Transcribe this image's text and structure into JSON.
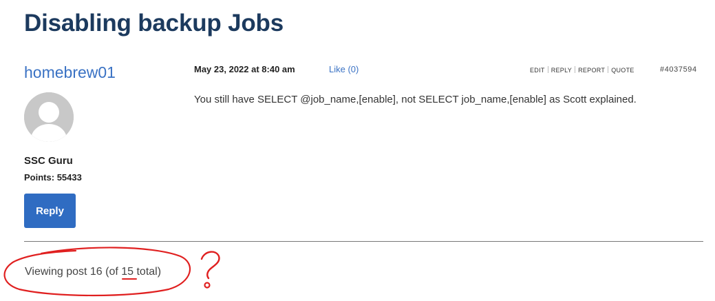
{
  "topic": {
    "title": "Disabling backup Jobs"
  },
  "author": {
    "name": "homebrew01",
    "rank": "SSC Guru",
    "points_label": "Points:",
    "points_value": "55433",
    "reply_label": "Reply"
  },
  "post": {
    "date": "May 23, 2022 at 8:40 am",
    "like_label": "Like (0)",
    "actions": [
      "EDIT",
      "REPLY",
      "REPORT",
      "QUOTE"
    ],
    "id": "#4037594",
    "content": "You still have SELECT @job_name,[enable], not SELECT job_name,[enable] as Scott explained."
  },
  "pagination": {
    "text": "Viewing post 16 (of 15 total)"
  },
  "annotation": {
    "color": "#e02020"
  }
}
